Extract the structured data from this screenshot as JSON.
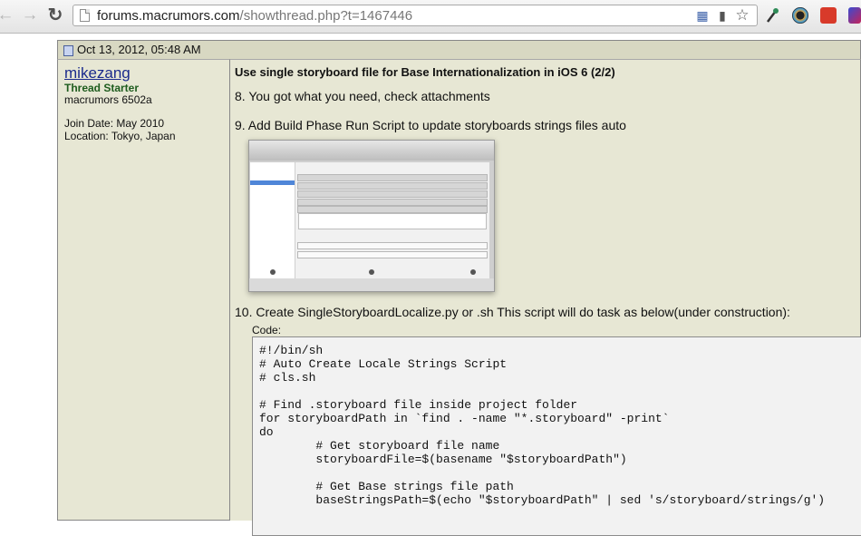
{
  "browser": {
    "url_domain": "forums.macrumors.com",
    "url_path": "/showthread.php?t=1467446"
  },
  "post": {
    "date": "Oct 13, 2012, 05:48 AM",
    "user": {
      "name": "mikezang",
      "title": "Thread Starter",
      "rank": "macrumors 6502a",
      "join_date": "Join Date: May 2010",
      "location": "Location: Tokyo, Japan"
    },
    "title": "Use single storyboard file for Base Internationalization in iOS 6 (2/2)",
    "steps": [
      "8. You got what you need, check attachments",
      "9. Add Build Phase Run Script to update storyboards strings files auto",
      "10. Create SingleStoryboardLocalize.py or .sh This script will do task as below(under construction):"
    ],
    "code_label": "Code:",
    "code_lines": [
      "#!/bin/sh",
      "# Auto Create Locale Strings Script",
      "# cls.sh",
      "",
      "# Find .storyboard file inside project folder",
      "for storyboardPath in `find . -name \"*.storyboard\" -print`",
      "do",
      "        # Get storyboard file name",
      "        storyboardFile=$(basename \"$storyboardPath\")",
      "",
      "        # Get Base strings file path",
      "        baseStringsPath=$(echo \"$storyboardPath\" | sed 's/storyboard/strings/g')"
    ]
  }
}
